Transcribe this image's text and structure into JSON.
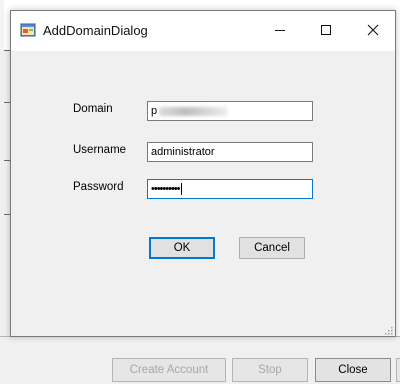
{
  "dialog": {
    "title": "AddDomainDialog",
    "caption_buttons": [
      "minimize-icon",
      "maximize-icon",
      "close-icon"
    ],
    "fields": {
      "domain": {
        "label": "Domain",
        "value": "p"
      },
      "username": {
        "label": "Username",
        "value": "administrator"
      },
      "password": {
        "label": "Password",
        "value": "••••••••••"
      }
    },
    "buttons": {
      "ok": "OK",
      "cancel": "Cancel"
    }
  },
  "background_window": {
    "buttons": {
      "create_account": "Create Account",
      "stop": "Stop",
      "close": "Close"
    }
  },
  "colors": {
    "focus_accent": "#0078d7",
    "dialog_face": "#f0f0f0",
    "titlebar": "#ffffff"
  }
}
